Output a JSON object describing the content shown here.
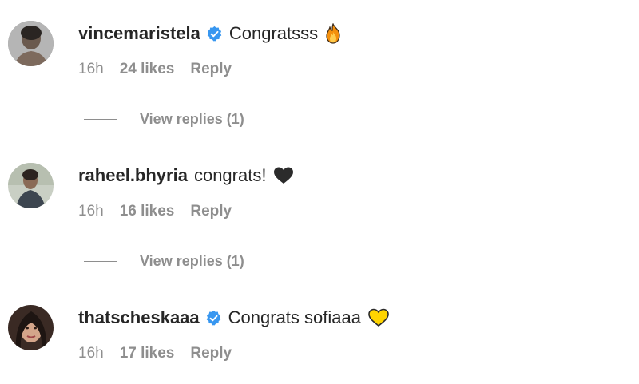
{
  "comments": [
    {
      "username": "vincemaristela",
      "verified": true,
      "text": "Congratsss",
      "emoji": "fire-emoji",
      "time": "16h",
      "likes": "24 likes",
      "reply_label": "Reply",
      "view_replies": "View replies (1)"
    },
    {
      "username": "raheel.bhyria",
      "verified": false,
      "text": "congrats!",
      "emoji": "black-heart-emoji",
      "time": "16h",
      "likes": "16 likes",
      "reply_label": "Reply",
      "view_replies": "View replies (1)"
    },
    {
      "username": "thatscheskaaa",
      "verified": true,
      "text": "Congrats sofiaaa",
      "emoji": "yellow-heart-emoji",
      "time": "16h",
      "likes": "17 likes",
      "reply_label": "Reply"
    }
  ],
  "colors": {
    "verified_blue": "#3897f0",
    "meta_gray": "#8e8e8e",
    "text_dark": "#262626",
    "yellow_heart": "#ffd400",
    "black_heart": "#2b2b2b"
  }
}
